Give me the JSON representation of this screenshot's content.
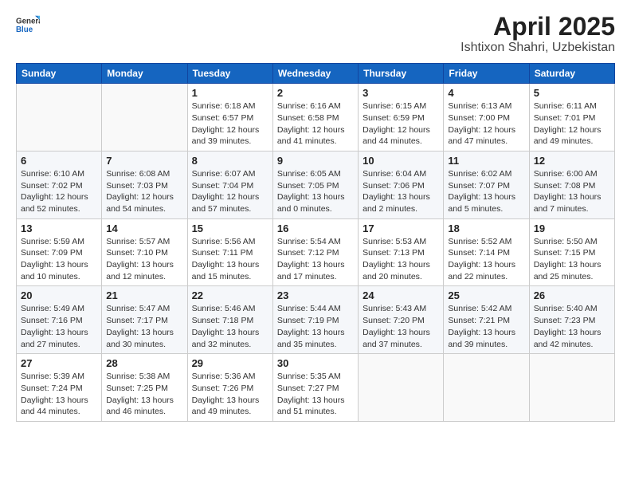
{
  "header": {
    "logo_general": "General",
    "logo_blue": "Blue",
    "title": "April 2025",
    "location": "Ishtixon Shahri, Uzbekistan"
  },
  "weekdays": [
    "Sunday",
    "Monday",
    "Tuesday",
    "Wednesday",
    "Thursday",
    "Friday",
    "Saturday"
  ],
  "weeks": [
    [
      {
        "day": "",
        "info": ""
      },
      {
        "day": "",
        "info": ""
      },
      {
        "day": "1",
        "sunrise": "Sunrise: 6:18 AM",
        "sunset": "Sunset: 6:57 PM",
        "daylight": "Daylight: 12 hours and 39 minutes."
      },
      {
        "day": "2",
        "sunrise": "Sunrise: 6:16 AM",
        "sunset": "Sunset: 6:58 PM",
        "daylight": "Daylight: 12 hours and 41 minutes."
      },
      {
        "day": "3",
        "sunrise": "Sunrise: 6:15 AM",
        "sunset": "Sunset: 6:59 PM",
        "daylight": "Daylight: 12 hours and 44 minutes."
      },
      {
        "day": "4",
        "sunrise": "Sunrise: 6:13 AM",
        "sunset": "Sunset: 7:00 PM",
        "daylight": "Daylight: 12 hours and 47 minutes."
      },
      {
        "day": "5",
        "sunrise": "Sunrise: 6:11 AM",
        "sunset": "Sunset: 7:01 PM",
        "daylight": "Daylight: 12 hours and 49 minutes."
      }
    ],
    [
      {
        "day": "6",
        "sunrise": "Sunrise: 6:10 AM",
        "sunset": "Sunset: 7:02 PM",
        "daylight": "Daylight: 12 hours and 52 minutes."
      },
      {
        "day": "7",
        "sunrise": "Sunrise: 6:08 AM",
        "sunset": "Sunset: 7:03 PM",
        "daylight": "Daylight: 12 hours and 54 minutes."
      },
      {
        "day": "8",
        "sunrise": "Sunrise: 6:07 AM",
        "sunset": "Sunset: 7:04 PM",
        "daylight": "Daylight: 12 hours and 57 minutes."
      },
      {
        "day": "9",
        "sunrise": "Sunrise: 6:05 AM",
        "sunset": "Sunset: 7:05 PM",
        "daylight": "Daylight: 13 hours and 0 minutes."
      },
      {
        "day": "10",
        "sunrise": "Sunrise: 6:04 AM",
        "sunset": "Sunset: 7:06 PM",
        "daylight": "Daylight: 13 hours and 2 minutes."
      },
      {
        "day": "11",
        "sunrise": "Sunrise: 6:02 AM",
        "sunset": "Sunset: 7:07 PM",
        "daylight": "Daylight: 13 hours and 5 minutes."
      },
      {
        "day": "12",
        "sunrise": "Sunrise: 6:00 AM",
        "sunset": "Sunset: 7:08 PM",
        "daylight": "Daylight: 13 hours and 7 minutes."
      }
    ],
    [
      {
        "day": "13",
        "sunrise": "Sunrise: 5:59 AM",
        "sunset": "Sunset: 7:09 PM",
        "daylight": "Daylight: 13 hours and 10 minutes."
      },
      {
        "day": "14",
        "sunrise": "Sunrise: 5:57 AM",
        "sunset": "Sunset: 7:10 PM",
        "daylight": "Daylight: 13 hours and 12 minutes."
      },
      {
        "day": "15",
        "sunrise": "Sunrise: 5:56 AM",
        "sunset": "Sunset: 7:11 PM",
        "daylight": "Daylight: 13 hours and 15 minutes."
      },
      {
        "day": "16",
        "sunrise": "Sunrise: 5:54 AM",
        "sunset": "Sunset: 7:12 PM",
        "daylight": "Daylight: 13 hours and 17 minutes."
      },
      {
        "day": "17",
        "sunrise": "Sunrise: 5:53 AM",
        "sunset": "Sunset: 7:13 PM",
        "daylight": "Daylight: 13 hours and 20 minutes."
      },
      {
        "day": "18",
        "sunrise": "Sunrise: 5:52 AM",
        "sunset": "Sunset: 7:14 PM",
        "daylight": "Daylight: 13 hours and 22 minutes."
      },
      {
        "day": "19",
        "sunrise": "Sunrise: 5:50 AM",
        "sunset": "Sunset: 7:15 PM",
        "daylight": "Daylight: 13 hours and 25 minutes."
      }
    ],
    [
      {
        "day": "20",
        "sunrise": "Sunrise: 5:49 AM",
        "sunset": "Sunset: 7:16 PM",
        "daylight": "Daylight: 13 hours and 27 minutes."
      },
      {
        "day": "21",
        "sunrise": "Sunrise: 5:47 AM",
        "sunset": "Sunset: 7:17 PM",
        "daylight": "Daylight: 13 hours and 30 minutes."
      },
      {
        "day": "22",
        "sunrise": "Sunrise: 5:46 AM",
        "sunset": "Sunset: 7:18 PM",
        "daylight": "Daylight: 13 hours and 32 minutes."
      },
      {
        "day": "23",
        "sunrise": "Sunrise: 5:44 AM",
        "sunset": "Sunset: 7:19 PM",
        "daylight": "Daylight: 13 hours and 35 minutes."
      },
      {
        "day": "24",
        "sunrise": "Sunrise: 5:43 AM",
        "sunset": "Sunset: 7:20 PM",
        "daylight": "Daylight: 13 hours and 37 minutes."
      },
      {
        "day": "25",
        "sunrise": "Sunrise: 5:42 AM",
        "sunset": "Sunset: 7:21 PM",
        "daylight": "Daylight: 13 hours and 39 minutes."
      },
      {
        "day": "26",
        "sunrise": "Sunrise: 5:40 AM",
        "sunset": "Sunset: 7:23 PM",
        "daylight": "Daylight: 13 hours and 42 minutes."
      }
    ],
    [
      {
        "day": "27",
        "sunrise": "Sunrise: 5:39 AM",
        "sunset": "Sunset: 7:24 PM",
        "daylight": "Daylight: 13 hours and 44 minutes."
      },
      {
        "day": "28",
        "sunrise": "Sunrise: 5:38 AM",
        "sunset": "Sunset: 7:25 PM",
        "daylight": "Daylight: 13 hours and 46 minutes."
      },
      {
        "day": "29",
        "sunrise": "Sunrise: 5:36 AM",
        "sunset": "Sunset: 7:26 PM",
        "daylight": "Daylight: 13 hours and 49 minutes."
      },
      {
        "day": "30",
        "sunrise": "Sunrise: 5:35 AM",
        "sunset": "Sunset: 7:27 PM",
        "daylight": "Daylight: 13 hours and 51 minutes."
      },
      {
        "day": "",
        "info": ""
      },
      {
        "day": "",
        "info": ""
      },
      {
        "day": "",
        "info": ""
      }
    ]
  ]
}
